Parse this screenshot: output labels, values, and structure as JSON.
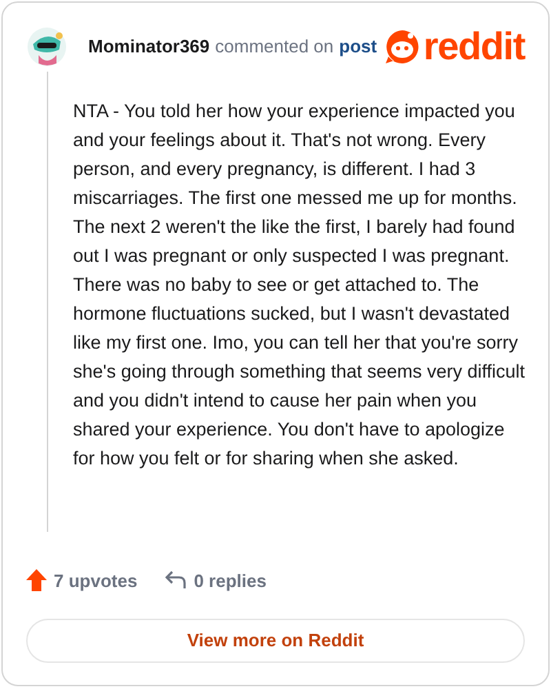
{
  "header": {
    "author": "Mominator369",
    "action": "commented on",
    "link": "post",
    "logo": "reddit"
  },
  "comment": {
    "body": "NTA - You told her how your experience impacted you and your feelings about it. That's not wrong. Every person, and every pregnancy, is different. I had 3 miscarriages. The first one messed me up for months. The next 2 weren't the like the first, I barely had found out I was pregnant or only suspected I was pregnant. There was no baby to see or get attached to. The hormone fluctuations sucked, but I wasn't devastated like my first one. Imo, you can tell her that you're sorry she's going through something that seems very difficult and you didn't intend to cause her pain when you shared your experience. You don't have to apologize for how you felt or for sharing when she asked."
  },
  "stats": {
    "upvotes": "7 upvotes",
    "replies": "0 replies"
  },
  "button": "View more on Reddit"
}
